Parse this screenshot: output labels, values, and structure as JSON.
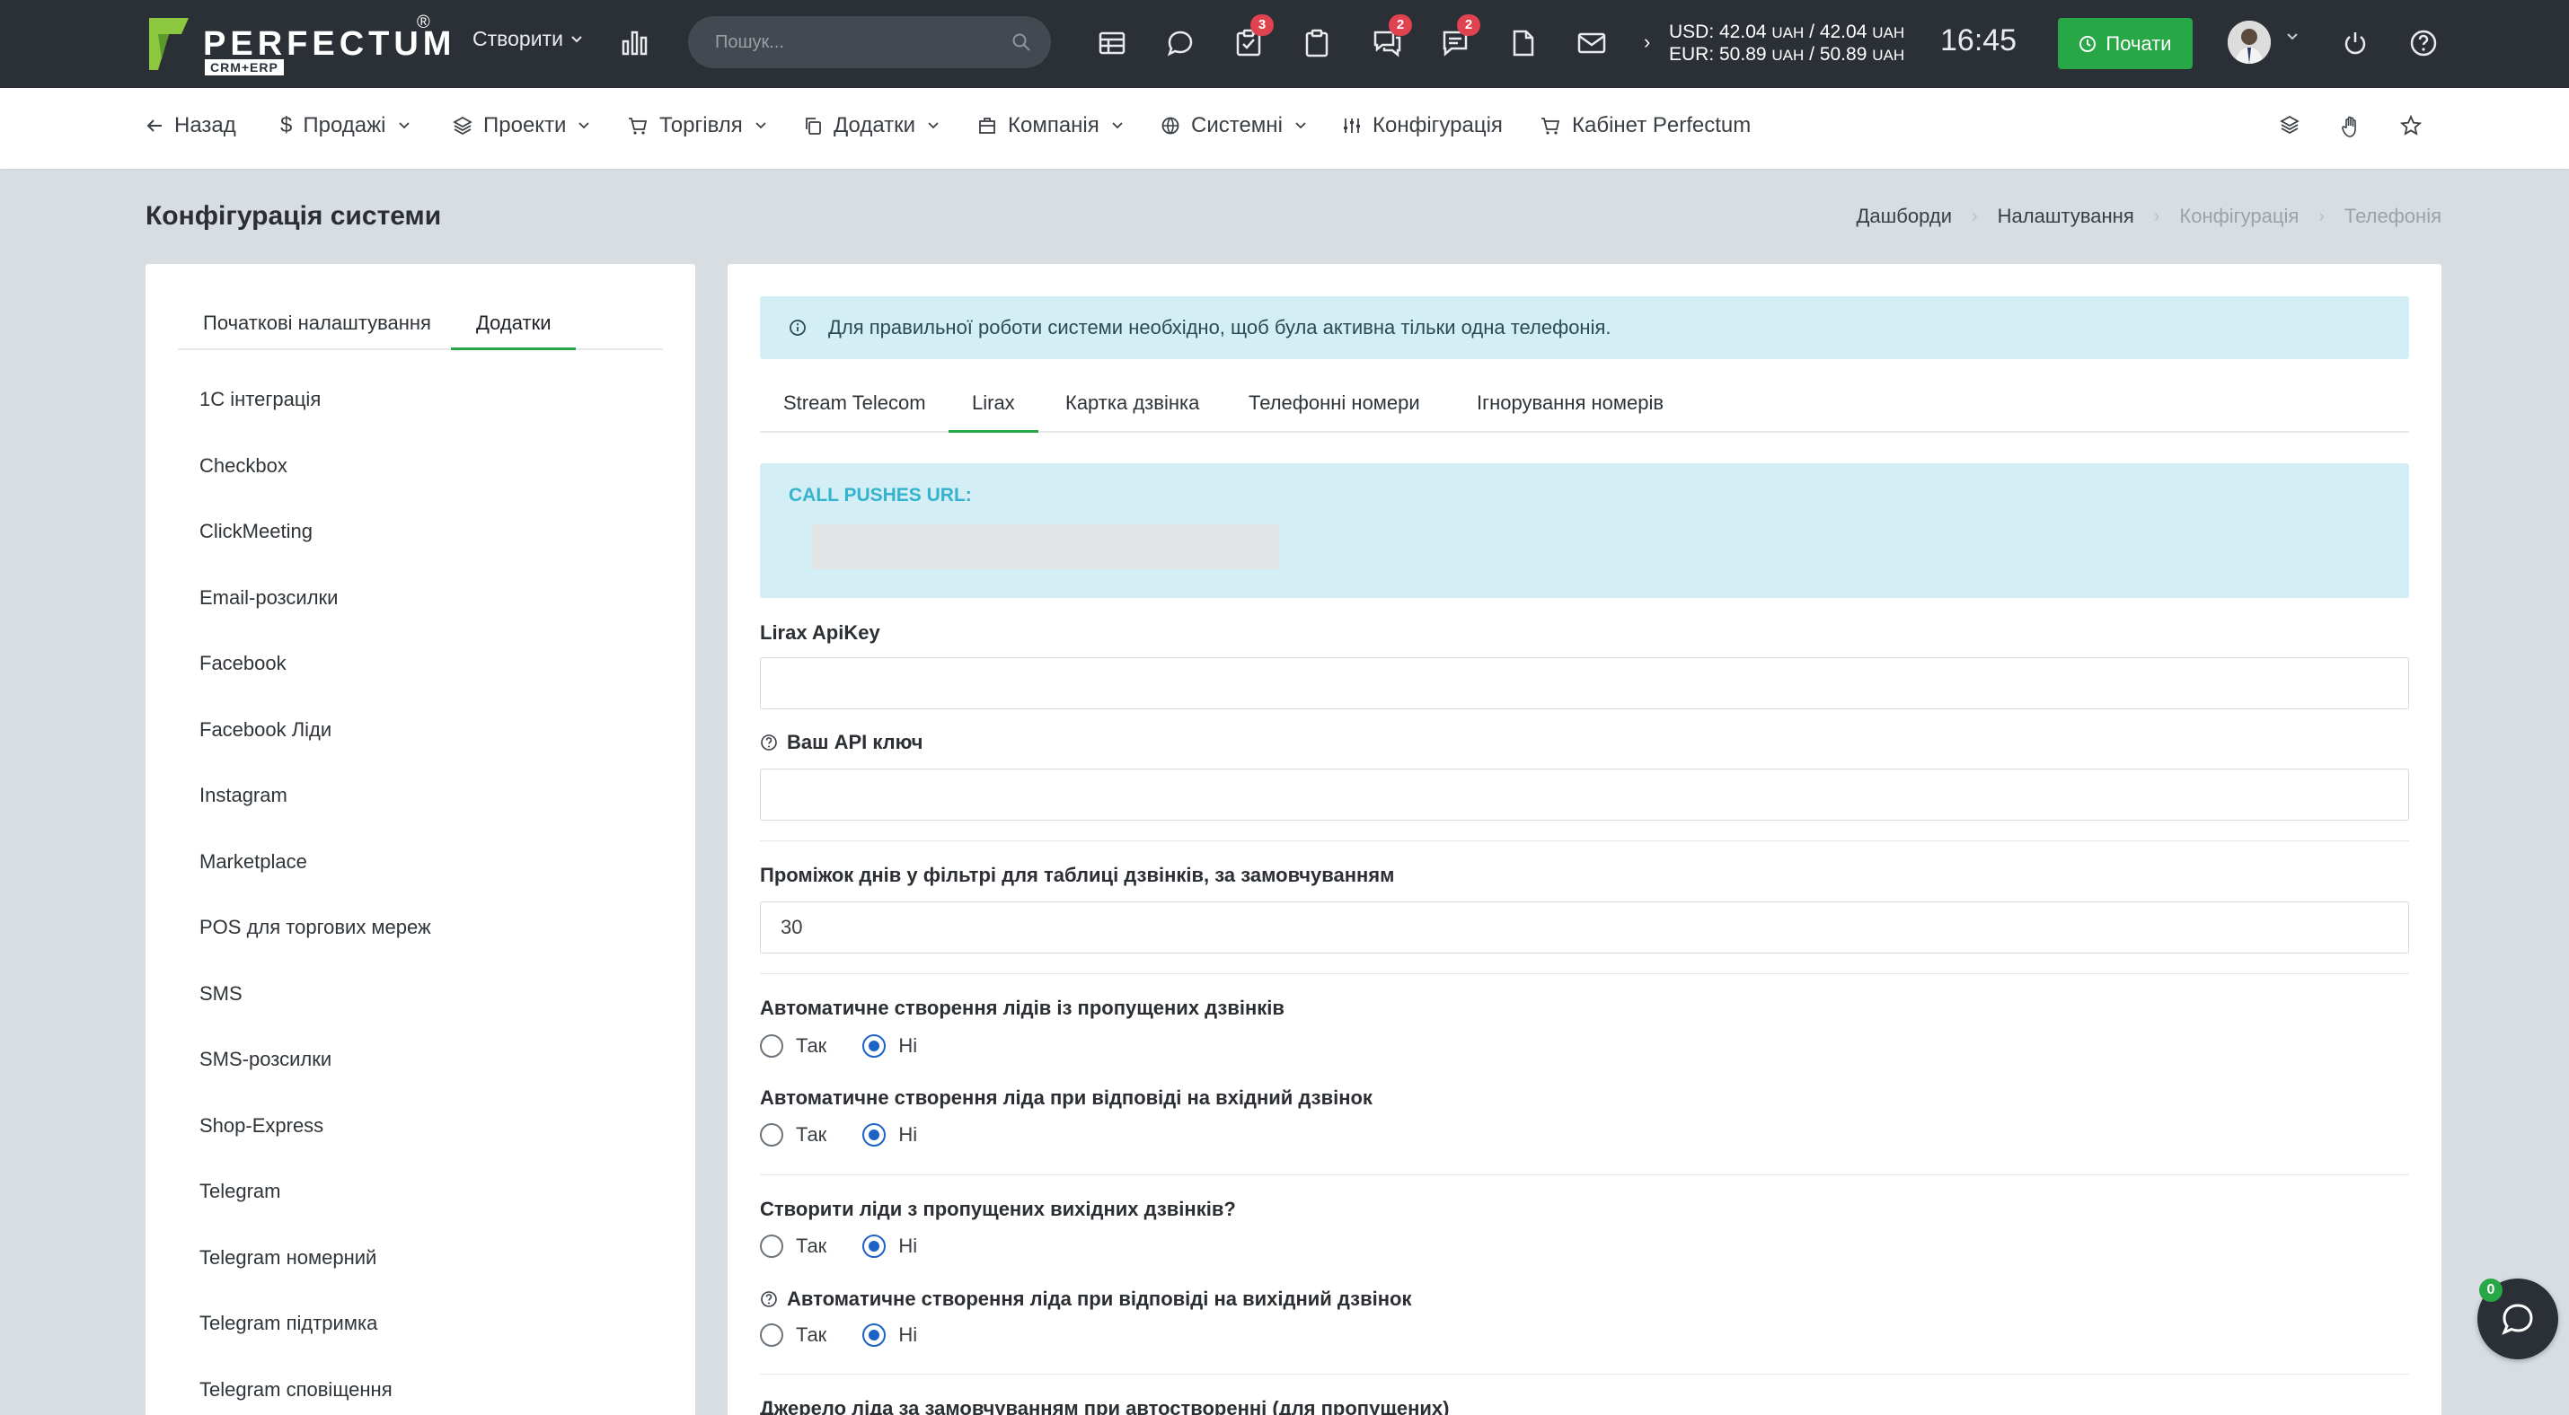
{
  "app": {
    "logo_text": "PERFECTUM",
    "logo_reg": "®",
    "logo_sub": "CRM+ERP"
  },
  "topbar": {
    "create_label": "Створити",
    "search_placeholder": "Пошук...",
    "badges": {
      "tasks": "3",
      "chat": "2",
      "messages": "2"
    },
    "currency_arrow": "›",
    "usd_label": "USD: 42.04",
    "usd_unit1": "UAH",
    "usd_sep": "/ 42.04",
    "usd_unit2": "UAH",
    "eur_label": "EUR: 50.89",
    "eur_unit1": "UAH",
    "eur_sep": "/ 50.89",
    "eur_unit2": "UAH",
    "time": "16:45",
    "start_label": "Почати"
  },
  "menu": {
    "back": "Назад",
    "sales": "Продажі",
    "projects": "Проекти",
    "trade": "Торгівля",
    "addons": "Додатки",
    "company": "Компанія",
    "system": "Системні",
    "config": "Конфігурація",
    "cabinet": "Кабінет Perfectum"
  },
  "page": {
    "title": "Конфігурація системи",
    "breadcrumbs": [
      "Дашборди",
      "Налаштування",
      "Конфігурація",
      "Телефонія"
    ],
    "breadcrumb_sep": "›"
  },
  "sidebar": {
    "tabs": [
      "Початкові налаштування",
      "Додатки"
    ],
    "items": [
      "1С інтеграція",
      "Checkbox",
      "ClickMeeting",
      "Email-розсилки",
      "Facebook",
      "Facebook Ліди",
      "Instagram",
      "Marketplace",
      "POS для торгових мереж",
      "SMS",
      "SMS-розсилки",
      "Shop-Express",
      "Telegram",
      "Telegram номерний",
      "Telegram підтримка",
      "Telegram сповіщення"
    ]
  },
  "main": {
    "alert": "Для правильної роботи системи необхідно, щоб була активна тільки одна телефонія.",
    "tabs": [
      "Stream Telecom",
      "Lirax",
      "Картка дзвінка",
      "Телефонні номери",
      "Ігнорування номерів"
    ],
    "push_label": "CALL PUSHES URL:",
    "apikey_label": "Lirax ApiKey",
    "apikey_value": "",
    "api_label": "Ваш API ключ",
    "api_value": "",
    "days_label": "Проміжок днів у фільтрі для таблиці дзвінків, за замовчуванням",
    "days_value": "30",
    "yes": "Так",
    "no": "Ні",
    "q1": "Автоматичне створення лідів із пропущених дзвінків",
    "q2": "Автоматичне створення ліда при відповіді на вхідний дзвінок",
    "q3": "Створити ліди з пропущених вихідних дзвінків?",
    "q4": "Автоматичне створення ліда при відповіді на вихідний дзвінок",
    "q5": "Джерело ліда за замовчуванням при автостворенні (для пропущених)"
  },
  "chat": {
    "badge": "0"
  },
  "colors": {
    "accent": "#27a745",
    "topbar": "#2b3036",
    "info_bg": "#d3eef5",
    "badge": "#e0424f",
    "radio": "#1d62c7"
  }
}
